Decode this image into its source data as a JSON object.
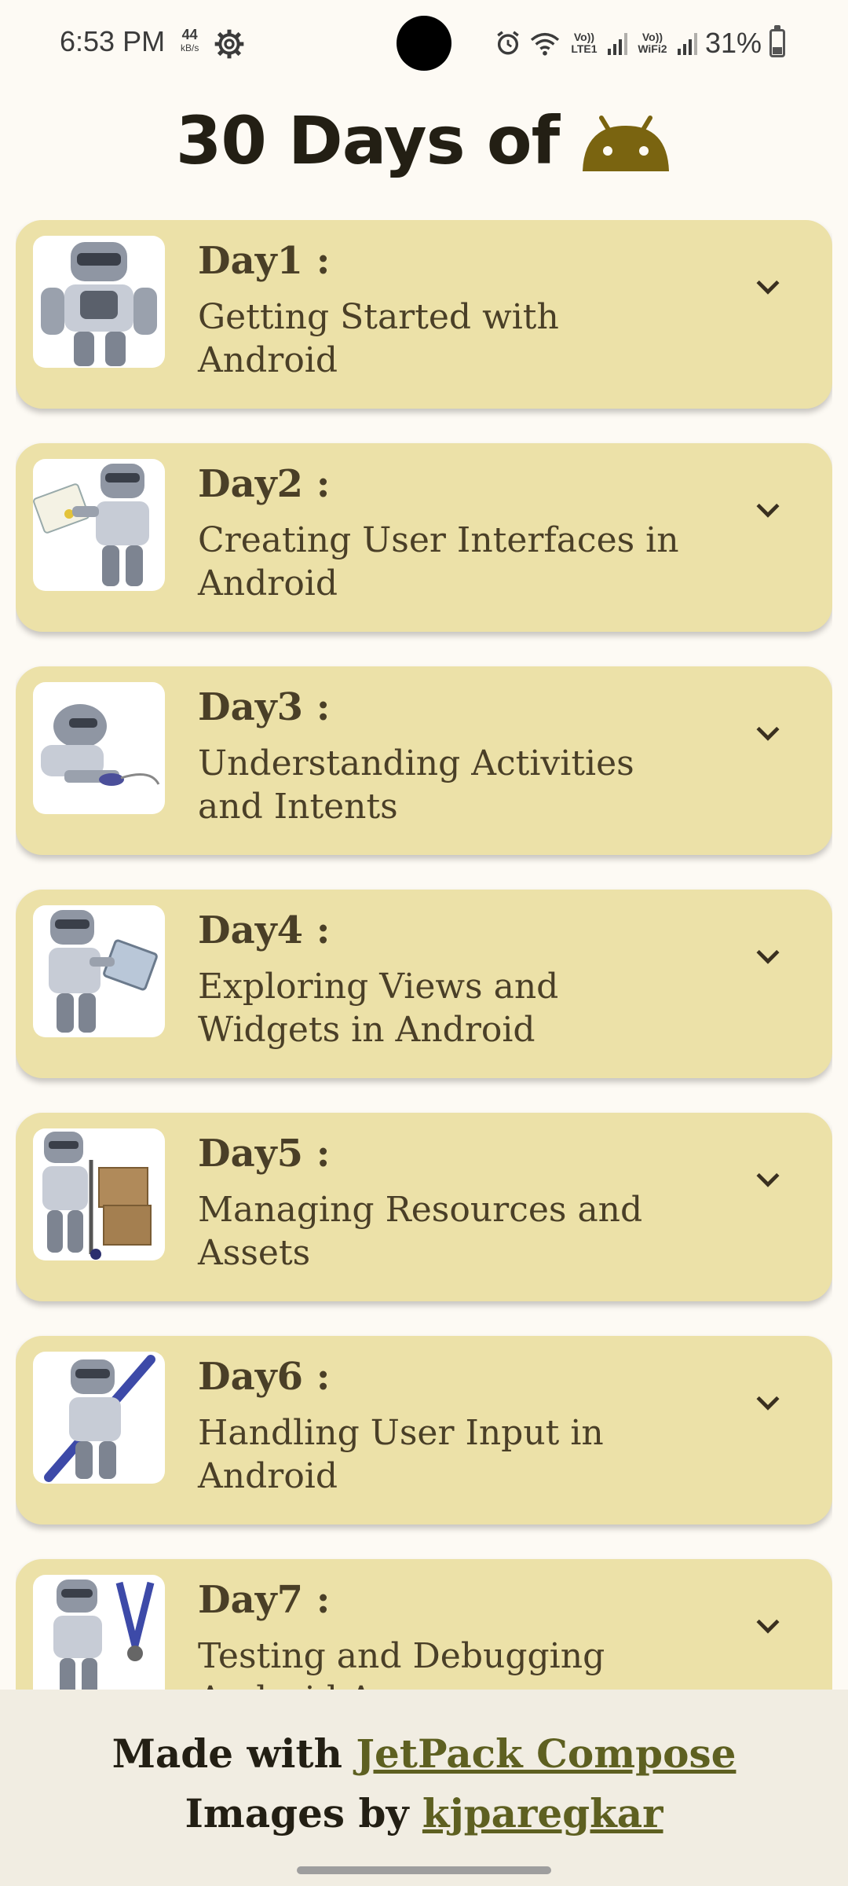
{
  "status_bar": {
    "time": "6:53 PM",
    "speed_value": "44",
    "speed_unit": "kB/s",
    "sim1": "Vo)) LTE1",
    "sim2": "Vo)) WiFi2",
    "battery": "31%"
  },
  "header": {
    "title": "30 Days of",
    "icon": "android-icon"
  },
  "cards": [
    {
      "day": "Day1 :",
      "title": "Getting Started with Android"
    },
    {
      "day": "Day2 :",
      "title": "Creating User Interfaces in Android"
    },
    {
      "day": "Day3 :",
      "title": "Understanding Activities and Intents"
    },
    {
      "day": "Day4 :",
      "title": "Exploring Views and Widgets in Android"
    },
    {
      "day": "Day5 :",
      "title": "Managing Resources and Assets"
    },
    {
      "day": "Day6 :",
      "title": "Handling User Input in Android"
    },
    {
      "day": "Day7 :",
      "title": "Testing and Debugging Android A..."
    }
  ],
  "footer": {
    "line1_prefix": "Made with ",
    "line1_link": "JetPack Compose",
    "line2_prefix": "Images by ",
    "line2_link": "kjparegkar"
  },
  "colors": {
    "background": "#FDFAF4",
    "card": "#ECE1A8",
    "text": "#4A3F27",
    "accent": "#7A6410",
    "link": "#5E6021"
  }
}
